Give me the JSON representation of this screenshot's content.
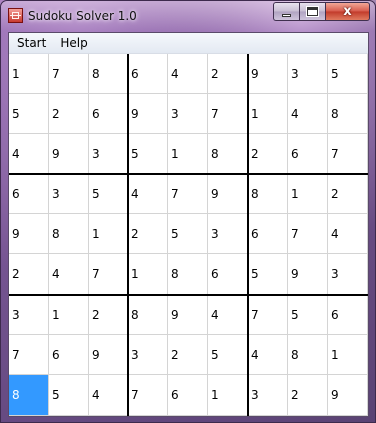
{
  "window": {
    "title": "Sudoku Solver 1.0",
    "close_glyph": "x"
  },
  "menu": {
    "items": [
      "Start",
      "Help"
    ]
  },
  "board": {
    "rows": [
      [
        "1",
        "7",
        "8",
        "6",
        "4",
        "2",
        "9",
        "3",
        "5"
      ],
      [
        "5",
        "2",
        "6",
        "9",
        "3",
        "7",
        "1",
        "4",
        "8"
      ],
      [
        "4",
        "9",
        "3",
        "5",
        "1",
        "8",
        "2",
        "6",
        "7"
      ],
      [
        "6",
        "3",
        "5",
        "4",
        "7",
        "9",
        "8",
        "1",
        "2"
      ],
      [
        "9",
        "8",
        "1",
        "2",
        "5",
        "3",
        "6",
        "7",
        "4"
      ],
      [
        "2",
        "4",
        "7",
        "1",
        "8",
        "6",
        "5",
        "9",
        "3"
      ],
      [
        "3",
        "1",
        "2",
        "8",
        "9",
        "4",
        "7",
        "5",
        "6"
      ],
      [
        "7",
        "6",
        "9",
        "3",
        "2",
        "5",
        "4",
        "8",
        "1"
      ],
      [
        "8",
        "5",
        "4",
        "7",
        "6",
        "1",
        "3",
        "2",
        "9"
      ]
    ],
    "selected": {
      "row": 8,
      "col": 0
    },
    "selection_color": "#3399ff"
  }
}
